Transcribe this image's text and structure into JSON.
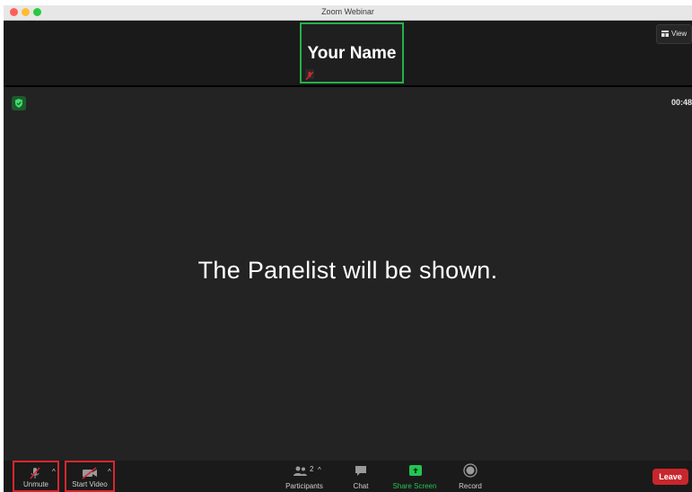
{
  "window": {
    "title": "Zoom Webinar"
  },
  "self_view": {
    "name": "Your Name"
  },
  "header": {
    "view_label": "View"
  },
  "stage": {
    "timer": "00:48",
    "message": "The Panelist will be shown."
  },
  "toolbar": {
    "unmute_label": "Unmute",
    "start_video_label": "Start Video",
    "participants_label": "Participants",
    "participants_count": "2",
    "chat_label": "Chat",
    "share_screen_label": "Share Screen",
    "record_label": "Record",
    "leave_label": "Leave"
  },
  "colors": {
    "highlight_green": "#23b24a",
    "highlight_red": "#d9262e",
    "share_green": "#23c552",
    "leave_red": "#c8262c"
  },
  "icons": [
    "muted-mic-icon",
    "video-off-icon",
    "participants-icon",
    "chat-icon",
    "share-screen-icon",
    "record-icon",
    "security-shield-icon",
    "view-grid-icon"
  ]
}
